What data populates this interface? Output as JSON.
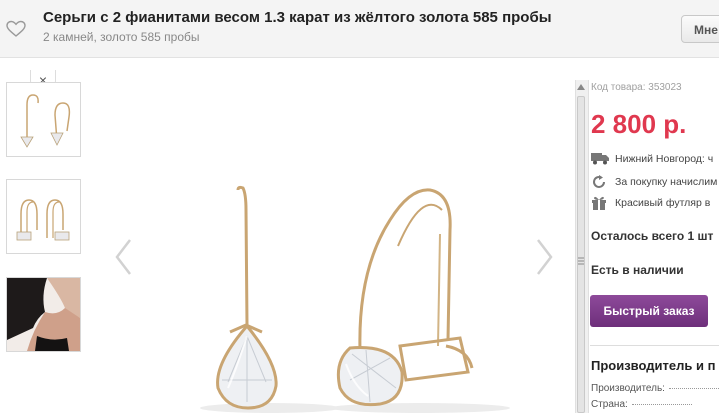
{
  "header": {
    "title": "Серьги с 2 фианитами весом 1.3 карат из жёлтого золота 585 пробы",
    "subtitle": "2 камней, золото 585 пробы",
    "more_label": "Мне"
  },
  "gallery": {
    "close_label": "×",
    "thumbnails": [
      "thumbnail-earrings-front",
      "thumbnail-earrings-side",
      "thumbnail-model-wearing"
    ]
  },
  "product": {
    "code": "Код товара: 353023",
    "price": "2 800 р.",
    "features": [
      {
        "icon": "truck-icon",
        "text": "Нижний Новгород: ч"
      },
      {
        "icon": "refresh-icon",
        "text": "За покупку начислим"
      },
      {
        "icon": "gift-icon",
        "text": "Красивый футляр в"
      }
    ],
    "remaining": "Осталось всего 1 шт",
    "in_stock": "Есть в наличии",
    "quick_order": "Быстрый заказ",
    "section_title": "Производитель и п",
    "specs": [
      "Производитель:",
      "Страна:"
    ]
  },
  "colors": {
    "price": "#e0384f",
    "accent_button": "#7a3787",
    "gold": "#c9a572"
  }
}
